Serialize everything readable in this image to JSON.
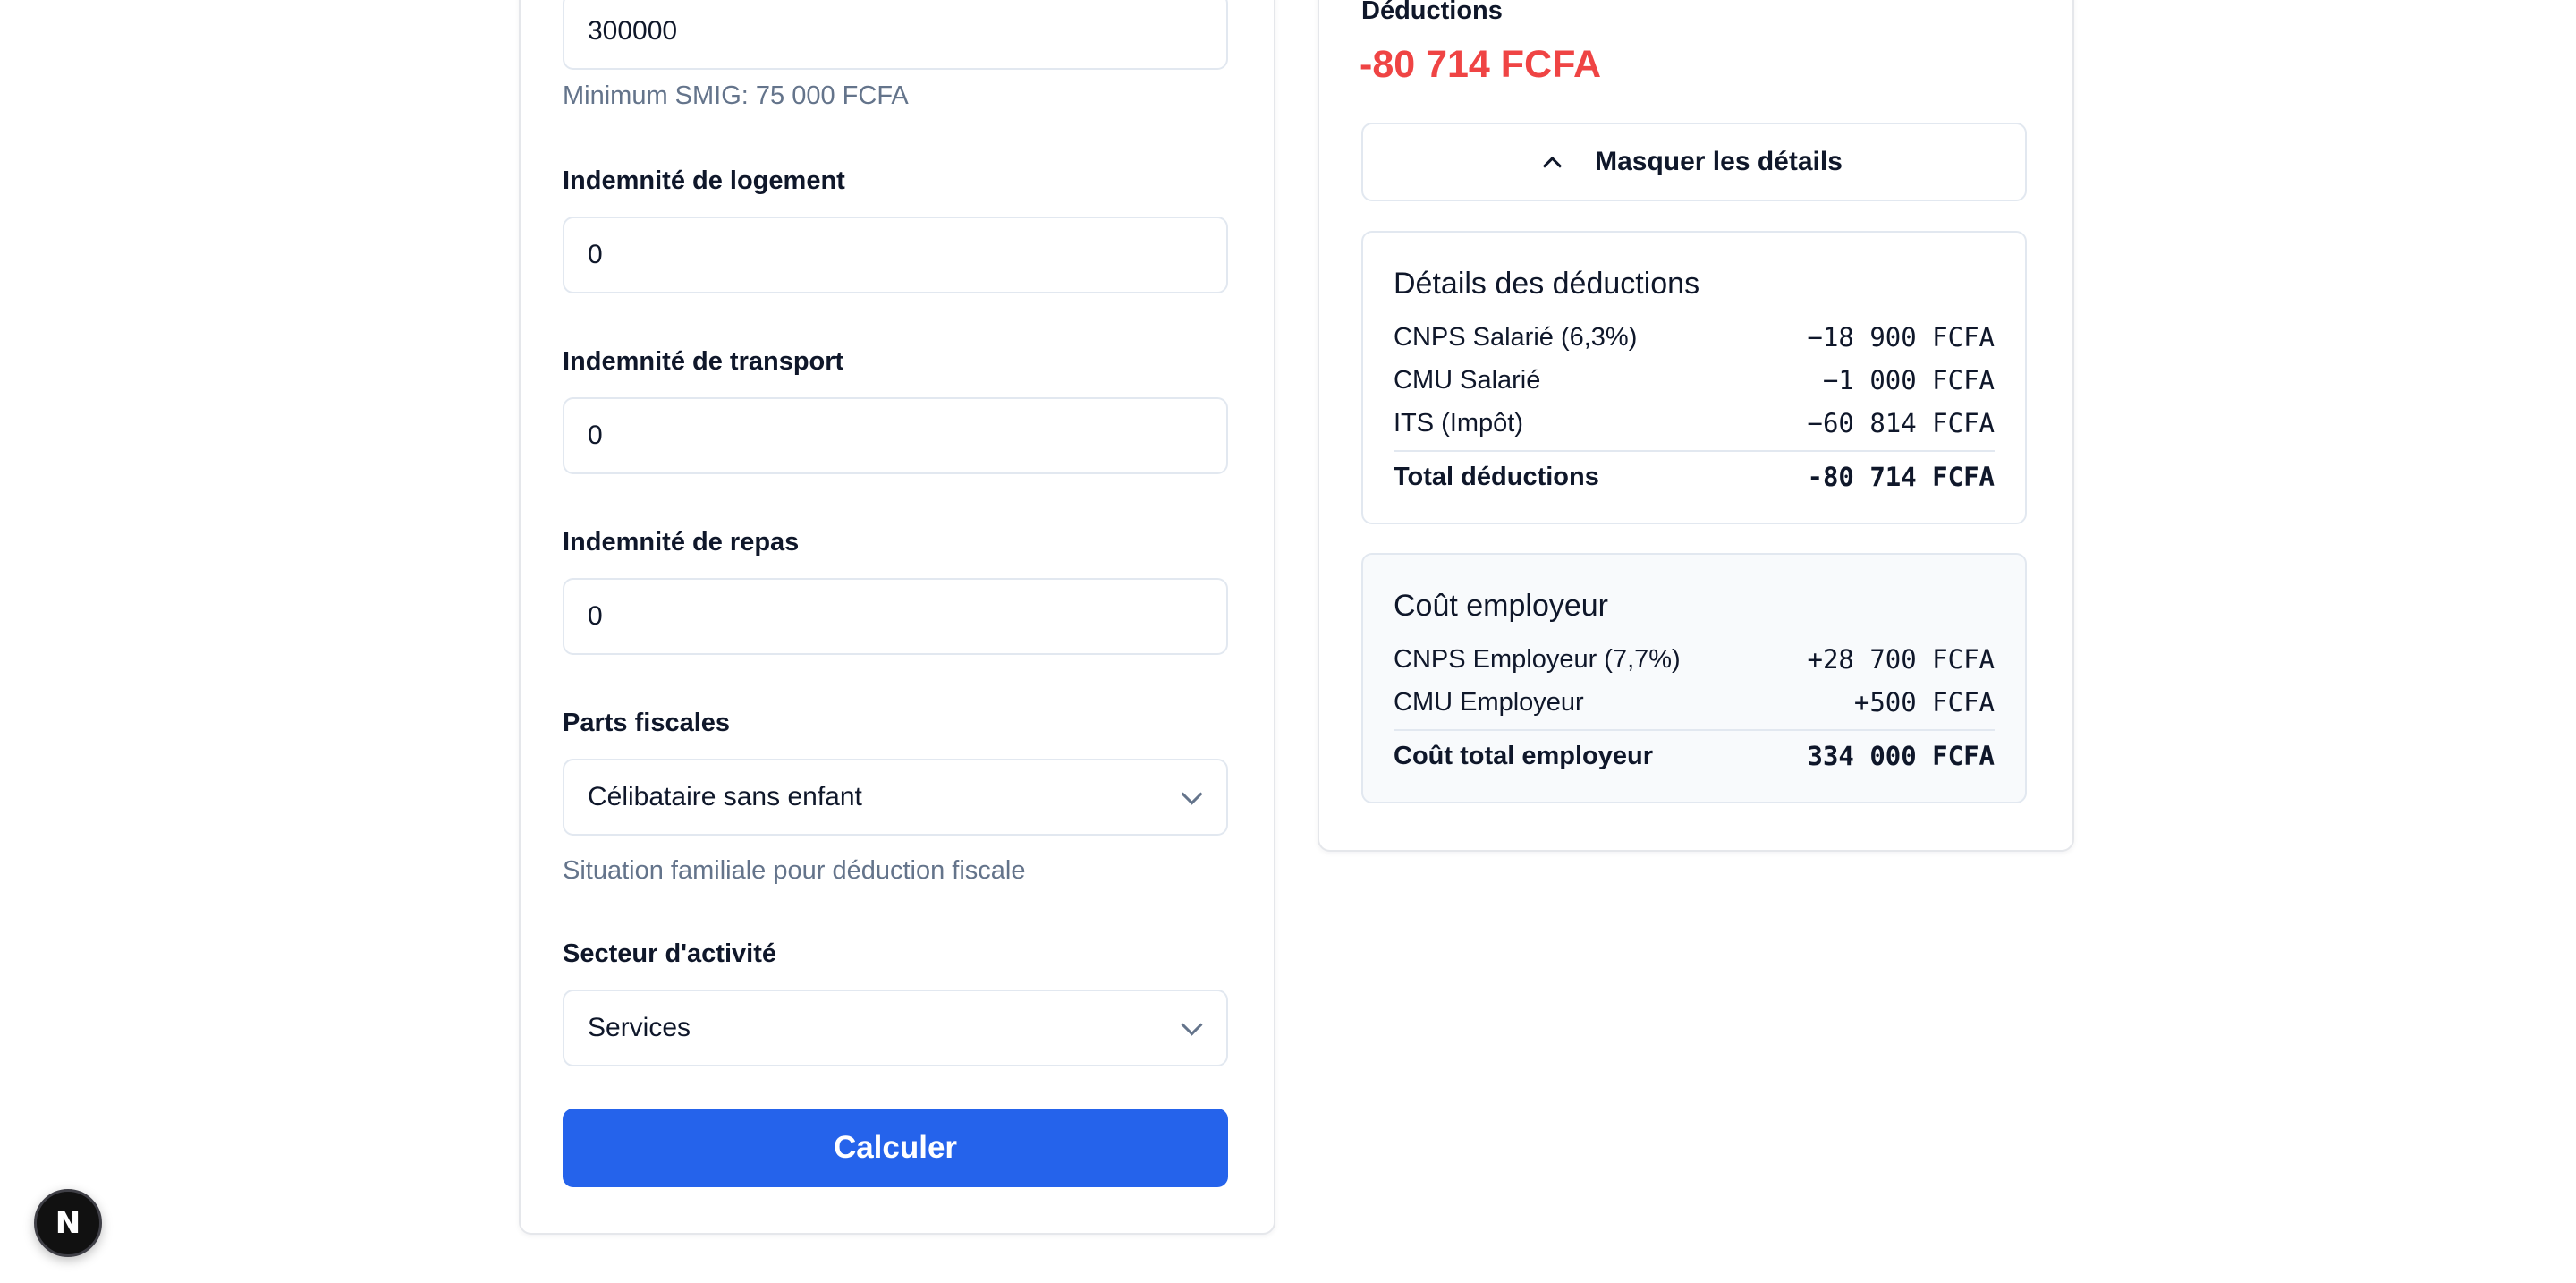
{
  "form": {
    "salary_value": "300000",
    "salary_help": "Minimum SMIG: 75 000 FCFA",
    "housing_label": "Indemnité de logement",
    "housing_value": "0",
    "transport_label": "Indemnité de transport",
    "transport_value": "0",
    "meal_label": "Indemnité de repas",
    "meal_value": "0",
    "parts_label": "Parts fiscales",
    "parts_value": "Célibataire sans enfant",
    "parts_help": "Situation familiale pour déduction fiscale",
    "sector_label": "Secteur d'activité",
    "sector_value": "Services",
    "submit_label": "Calculer"
  },
  "results": {
    "deductions_label": "Déductions",
    "deductions_amount": "-80 714 FCFA",
    "deductions_color": "#ef4444",
    "toggle_label": "Masquer les détails",
    "deductions_detail": {
      "title": "Détails des déductions",
      "rows": [
        {
          "label": "CNPS Salarié (6,3%)",
          "value": "−18 900 FCFA"
        },
        {
          "label": "CMU Salarié",
          "value": "−1 000 FCFA"
        },
        {
          "label": "ITS (Impôt)",
          "value": "−60 814 FCFA"
        }
      ],
      "total_label": "Total déductions",
      "total_value": "-80 714 FCFA"
    },
    "employer_detail": {
      "title": "Coût employeur",
      "rows": [
        {
          "label": "CNPS Employeur (7,7%)",
          "value": "+28 700 FCFA"
        },
        {
          "label": "CMU Employeur",
          "value": "+500 FCFA"
        }
      ],
      "total_label": "Coût total employeur",
      "total_value": "334 000 FCFA"
    }
  },
  "dev_badge": {
    "letter": "N",
    "icon": "nextjs-logo-icon"
  },
  "colors": {
    "primary": "#2563eb",
    "negative": "#ef4444",
    "muted_text": "#64748b",
    "border": "#e2e8f0"
  }
}
